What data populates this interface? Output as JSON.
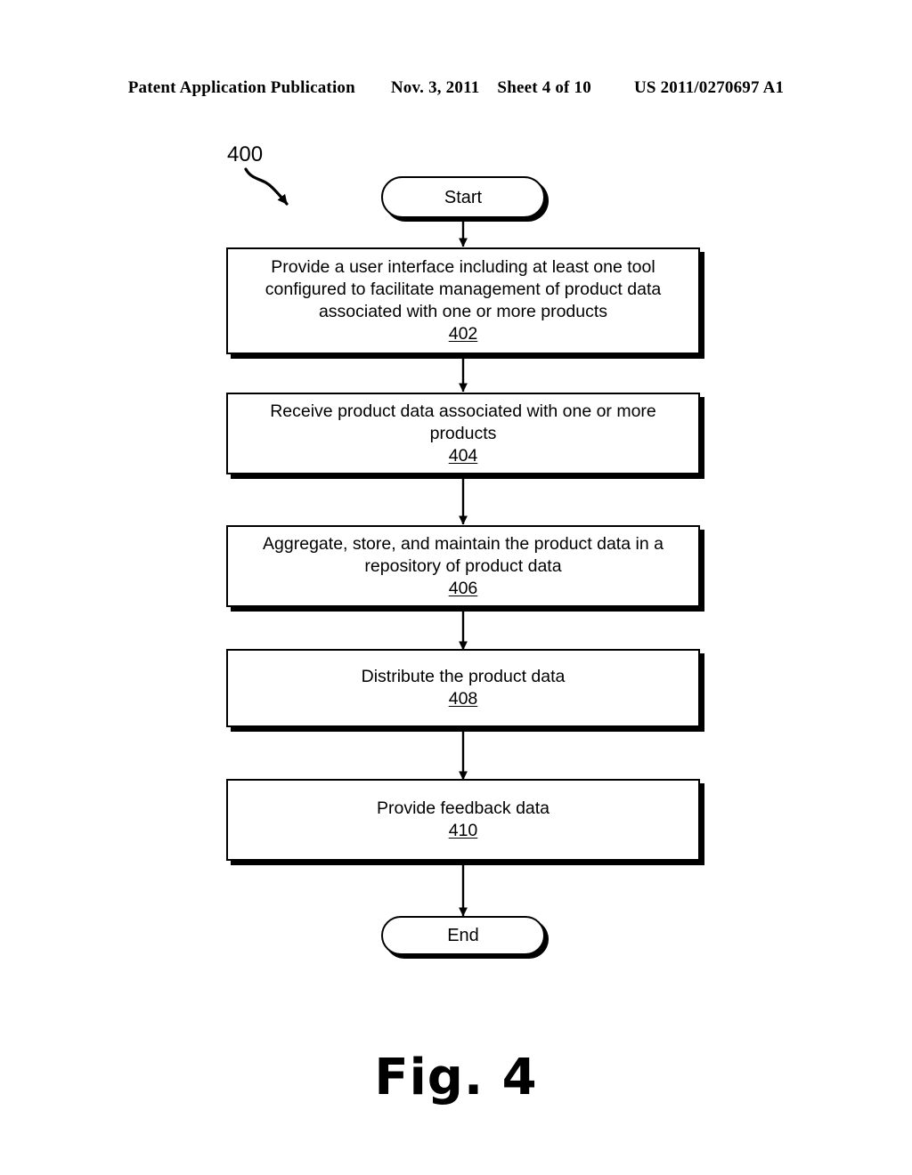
{
  "header": {
    "publication": "Patent Application Publication",
    "date": "Nov. 3, 2011",
    "sheet": "Sheet 4 of 10",
    "patent_number": "US 2011/0270697 A1"
  },
  "figure": {
    "caption": "Fig. 4",
    "callout_label": "400"
  },
  "flowchart": {
    "start": {
      "label": "Start"
    },
    "end": {
      "label": "End"
    },
    "steps": [
      {
        "text": "Provide a user interface including at least one tool\nconfigured to facilitate management of product data\nassociated with one or more products",
        "ref": "402"
      },
      {
        "text": "Receive product data associated with one or more\nproducts",
        "ref": "404"
      },
      {
        "text": "Aggregate, store, and maintain the product data in a\nrepository of product data",
        "ref": "406"
      },
      {
        "text": "Distribute the product data",
        "ref": "408"
      },
      {
        "text": "Provide feedback data",
        "ref": "410"
      }
    ]
  }
}
